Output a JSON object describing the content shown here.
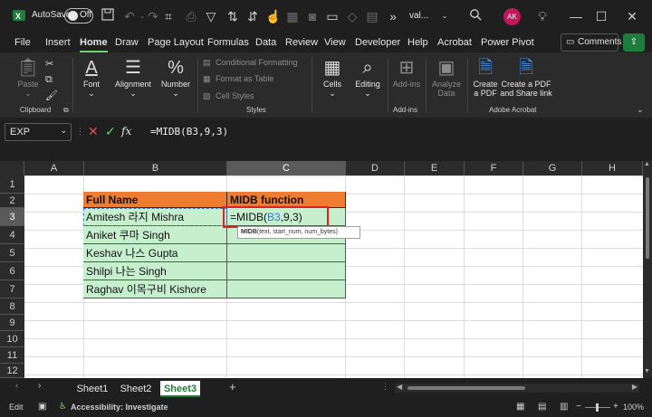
{
  "titlebar": {
    "autosave_label": "AutoSave",
    "autosave_state": "Off",
    "filename": "val...",
    "avatar_initials": "AK"
  },
  "menu": [
    "File",
    "Insert",
    "Home",
    "Draw",
    "Page Layout",
    "Formulas",
    "Data",
    "Review",
    "View",
    "Developer",
    "Help",
    "Acrobat",
    "Power Pivot"
  ],
  "menu_active": "Home",
  "comments_label": "Comments",
  "ribbon": {
    "paste": "Paste",
    "clipboard": "Clipboard",
    "font": "Font",
    "alignment": "Alignment",
    "number": "Number",
    "conditional_formatting": "Conditional Formatting",
    "format_as_table": "Format as Table",
    "cell_styles": "Cell Styles",
    "styles": "Styles",
    "cells": "Cells",
    "editing": "Editing",
    "add_ins": "Add-ins",
    "add_ins_group": "Add-ins",
    "analyze_data_1": "Analyze",
    "analyze_data_2": "Data",
    "create_pdf_1": "Create",
    "create_pdf_2": "a PDF",
    "create_share_1": "Create a PDF",
    "create_share_2": "and Share link",
    "adobe_acrobat": "Adobe Acrobat"
  },
  "formula_bar": {
    "name_box": "EXP",
    "fx": "fx",
    "formula": "=MIDB(B3,9,3)"
  },
  "columns": [
    "A",
    "B",
    "C",
    "D",
    "E",
    "F",
    "G",
    "H"
  ],
  "rows": [
    "1",
    "2",
    "3",
    "4",
    "5",
    "6",
    "7",
    "8",
    "9",
    "10",
    "11",
    "12"
  ],
  "table": {
    "header_name": "Full Name",
    "header_func": "MIDB function",
    "names": [
      "Amitesh 라지 Mishra",
      "Aniket 쿠마 Singh",
      "Keshav 나스 Gupta",
      "Shilpi 나는  Singh",
      "Raghav 이목구비 Kishore"
    ],
    "edit_prefix": "=MIDB(",
    "edit_ref": "B3",
    "edit_suffix": ",9,3)",
    "tooltip_fn": "MIDB",
    "tooltip_args": "(text, start_num, num_bytes)"
  },
  "sheets": [
    "Sheet1",
    "Sheet2",
    "Sheet3"
  ],
  "active_sheet": "Sheet3",
  "status": {
    "mode": "Edit",
    "accessibility": "Accessibility: Investigate",
    "zoom": "100%"
  }
}
